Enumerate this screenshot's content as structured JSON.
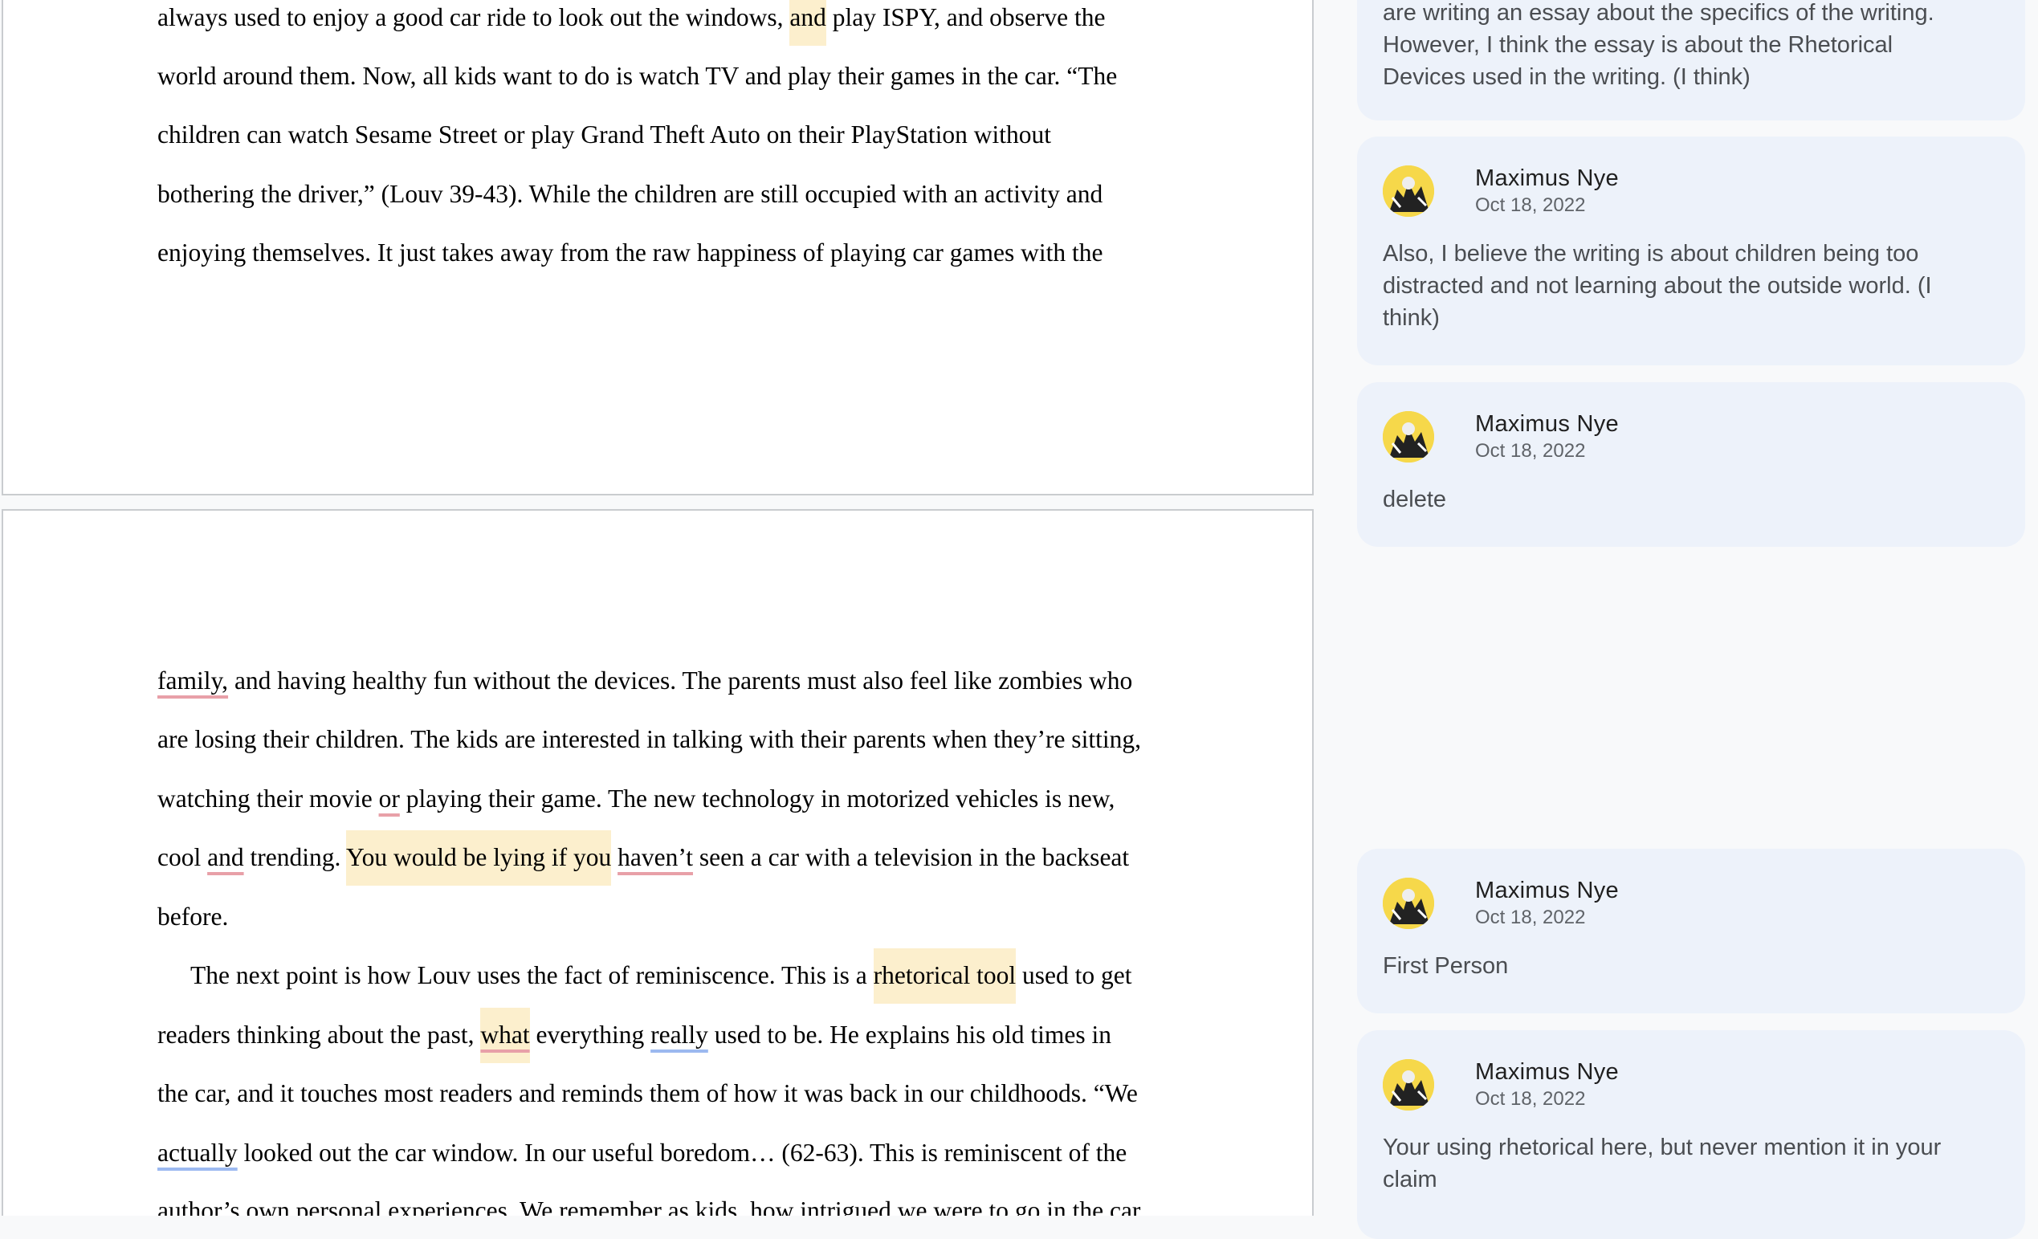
{
  "document": {
    "page1_lines": [
      [
        "always used to enjoy a good car ride to look out the windows, ",
        "and",
        " play ISPY, and observe the"
      ],
      "world around them. Now, all kids want to do is watch TV and play their games in the car. “The",
      "children can watch Sesame Street or play Grand Theft Auto on their PlayStation without",
      "bothering the driver,” (Louv 39-43). While the children are still occupied with an activity and",
      "enjoying themselves. It just takes away from the raw happiness of playing car games with the"
    ],
    "p2": {
      "l1_a": "family,",
      "l1_b": " and having healthy fun without the devices. The parents must also feel like zombies who",
      "l2": "are losing their children. The kids are interested in talking with their parents when they’re sitting,",
      "l3_a": "watching their movie ",
      "l3_b": "or",
      "l3_c": " playing their game. The new technology in motorized vehicles is new,",
      "l4_a": "cool ",
      "l4_b": "and",
      "l4_c": " trending. ",
      "l4_d": "You would be lying if you",
      "l4_e": " ",
      "l4_f": "haven’t",
      "l4_g": " seen a car with a television in the backseat",
      "l5": "before.",
      "l6_a": "The next point is how Louv uses the fact of reminiscence. This is a ",
      "l6_b": "rhetorical tool",
      "l6_c": " used to get",
      "l7_a": "readers thinking about the past, ",
      "l7_b": "what",
      "l7_c": " everything ",
      "l7_d": "really",
      "l7_e": " used to be. He explains his old times in",
      "l8": "the car, and it touches most readers and reminds them of how it was back in our childhoods. “We",
      "l9_a": "actually",
      "l9_b": " looked out the car window. In our useful boredom… (62-63). This is reminiscent of the",
      "l10": "author’s own personal experiences. We remember as kids, how intrigued we were to go in the car"
    }
  },
  "comments": [
    {
      "body_lines": [
        "are writing an essay about the specifics of the writing.",
        "However, I think the essay is about the Rhetorical",
        "Devices used in the writing. (I think)"
      ]
    },
    {
      "author": "Maximus Nye",
      "date": "Oct 18, 2022",
      "body_lines": [
        "Also, I believe the writing is about children being too",
        "distracted and not learning about the outside world. (I",
        "think)"
      ]
    },
    {
      "author": "Maximus Nye",
      "date": "Oct 18, 2022",
      "body_lines": [
        "delete"
      ]
    },
    {
      "author": "Maximus Nye",
      "date": "Oct 18, 2022",
      "body_lines": [
        "First Person"
      ]
    },
    {
      "author": "Maximus Nye",
      "date": "Oct 18, 2022",
      "body_lines": [
        "Your using rhetorical here, but never mention it in your",
        "claim"
      ]
    }
  ],
  "colors": {
    "highlight": "#fcefcd",
    "spell_underline": "#e8a0a8",
    "grammar_underline": "#9cb9f0",
    "comment_card": "#edf2fa"
  }
}
